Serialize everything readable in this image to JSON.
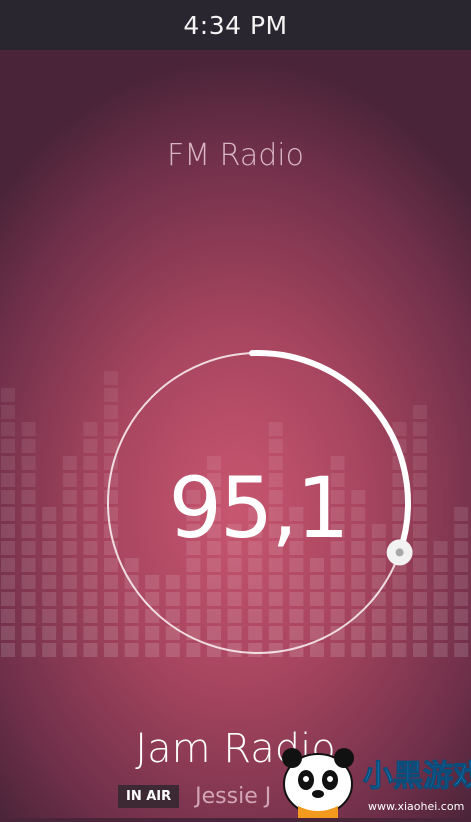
{
  "status": {
    "time": "4:34 PM"
  },
  "app": {
    "title": "FM Radio"
  },
  "tuner": {
    "frequency": "95,1",
    "progress": 0.2
  },
  "now_playing": {
    "station": "Jam Radio",
    "badge": "IN AIR",
    "artist": "Jessie J"
  },
  "watermark": {
    "brand": "小黑游戏",
    "url": "www.xiaohei.com"
  },
  "colors": {
    "accent": "#ffffff",
    "background": "#a7455f",
    "status_bar": "#2a2630"
  }
}
